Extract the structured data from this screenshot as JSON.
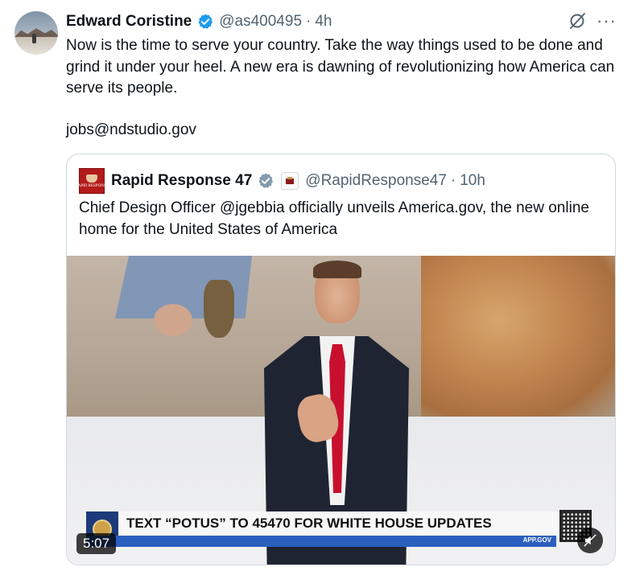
{
  "post": {
    "author_name": "Edward Coristine",
    "handle": "@as400495",
    "separator": "·",
    "time": "4h",
    "text": "Now is the time to serve your country. Take the way things used to be done and grind it under your heel. A new era is dawning of revolutionizing how America can serve its people.",
    "email": "jobs@ndstudio.gov"
  },
  "icons": {
    "verified": "verified-badge-icon",
    "grok": "grok-icon",
    "more": "more-icon",
    "mute": "mute-icon"
  },
  "quote": {
    "author_name": "Rapid Response 47",
    "avatar_text": "RAPID RESPONSE",
    "handle": "@RapidResponse47",
    "separator": "·",
    "time": "10h",
    "text": "Chief Design Officer @jgebbia officially unveils America.gov, the new online home for the United States of America"
  },
  "video": {
    "lower_third": "TEXT “POTUS” TO 45470 FOR WHITE HOUSE UPDATES",
    "bar_label": "APP.GOV",
    "duration": "5:07"
  },
  "colors": {
    "verified_blue": "#1d9bf0",
    "text_primary": "#0f1419",
    "text_secondary": "#536471",
    "border": "#cfd9de",
    "tie_red": "#c8102e",
    "bar_blue": "#2b5fbf"
  }
}
